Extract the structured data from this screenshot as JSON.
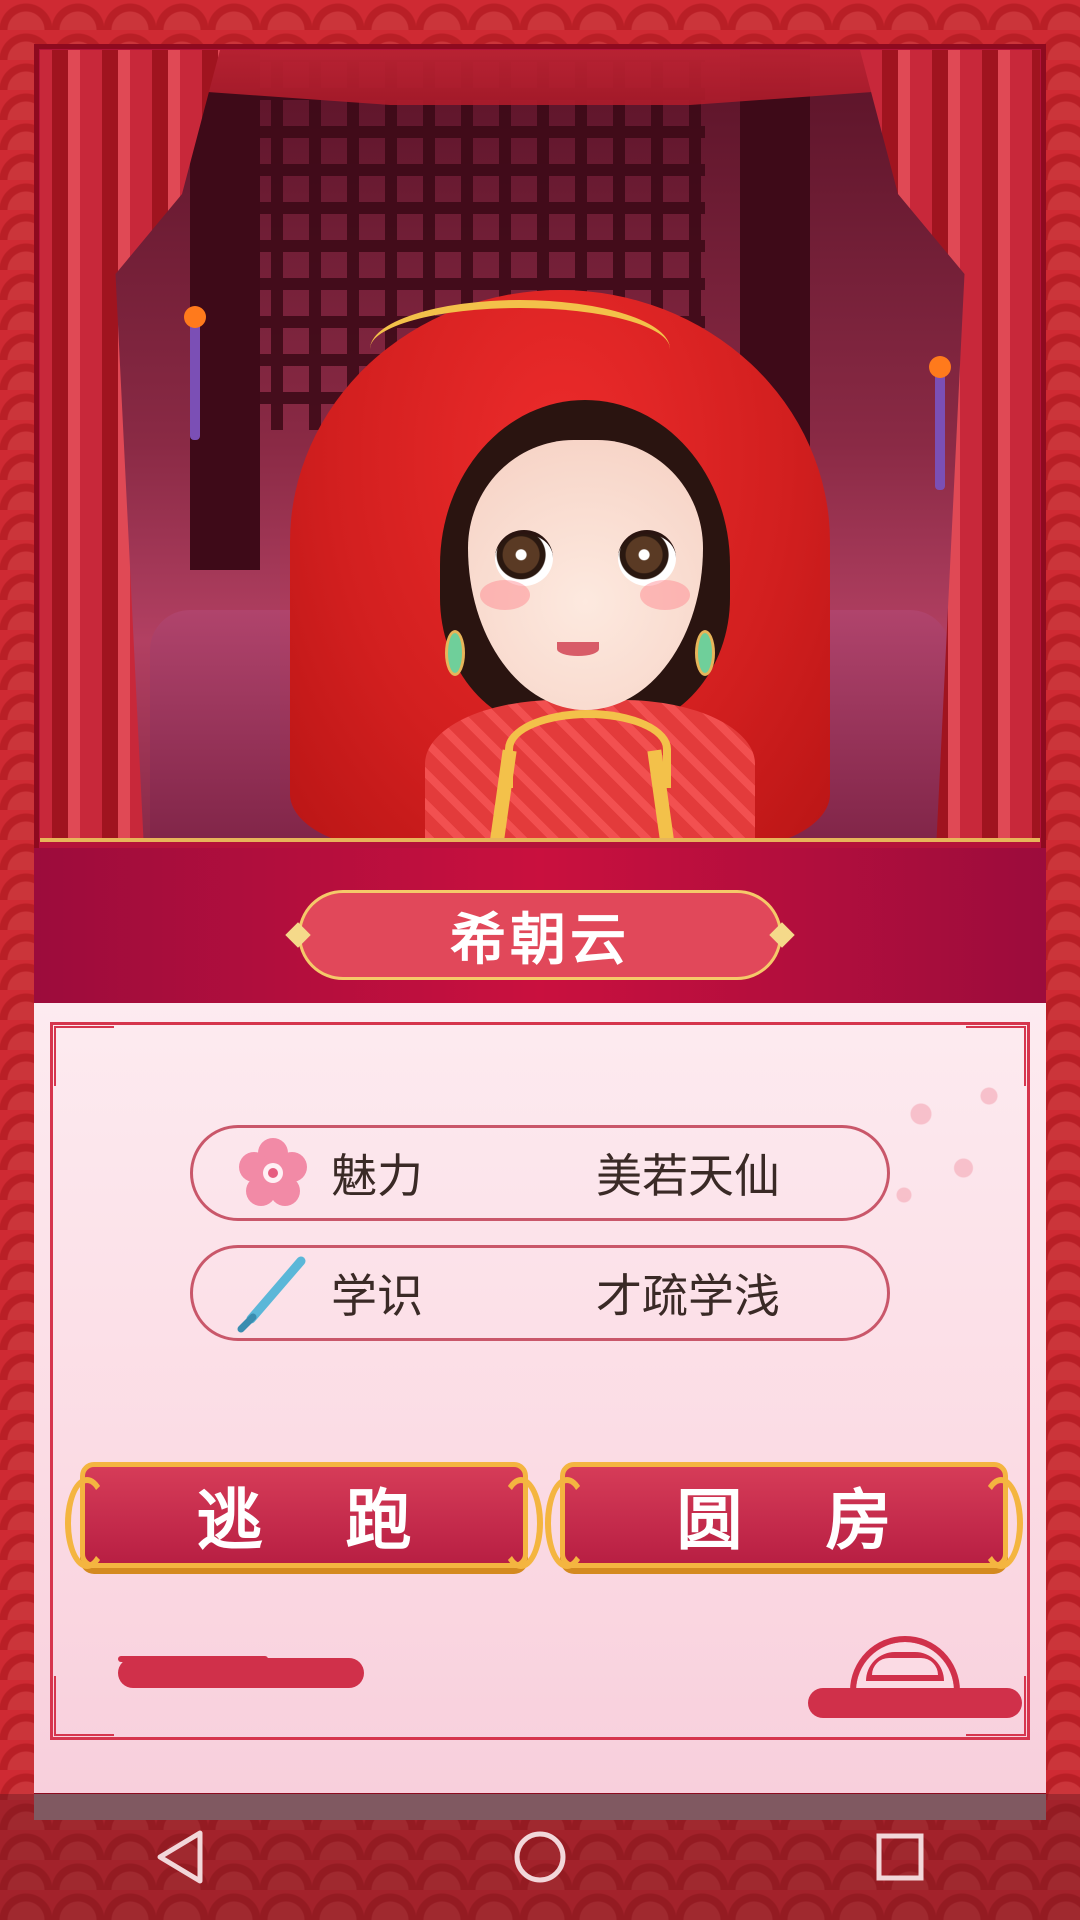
{
  "character": {
    "name": "希朝云"
  },
  "stats": [
    {
      "icon": "plum-blossom-icon",
      "label": "魅力",
      "value": "美若天仙"
    },
    {
      "icon": "writing-brush-icon",
      "label": "学识",
      "value": "才疏学浅"
    }
  ],
  "actions": {
    "escape_label": "逃 跑",
    "consummate_label": "圆 房"
  },
  "nav": {
    "back_icon": "back-triangle-icon",
    "home_icon": "home-circle-icon",
    "recents_icon": "recents-square-icon"
  },
  "colors": {
    "accent": "#cf2a33",
    "gold": "#f4b540",
    "button": "#c92b4b"
  }
}
